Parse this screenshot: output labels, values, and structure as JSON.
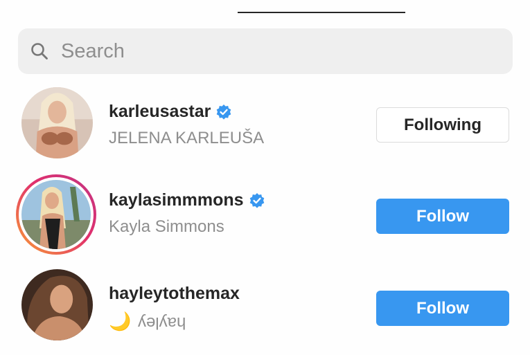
{
  "search": {
    "placeholder": "Search",
    "icon": "search-icon"
  },
  "accent_color": "#3897f0",
  "verified_color": "#3897f0",
  "users": [
    {
      "username": "karleusastar",
      "full_name": "JELENA KARLEUŠA",
      "verified": true,
      "has_story_ring": false,
      "button_label": "Following"
    },
    {
      "username": "kaylasimmmons",
      "full_name": "Kayla Simmons",
      "verified": true,
      "has_story_ring": true,
      "button_label": "Follow"
    },
    {
      "username": "hayleytothemax",
      "full_name_prefix": "🌙",
      "full_name": "hayley",
      "full_name_style": "upside-down",
      "verified": false,
      "has_story_ring": false,
      "button_label": "Follow"
    }
  ]
}
